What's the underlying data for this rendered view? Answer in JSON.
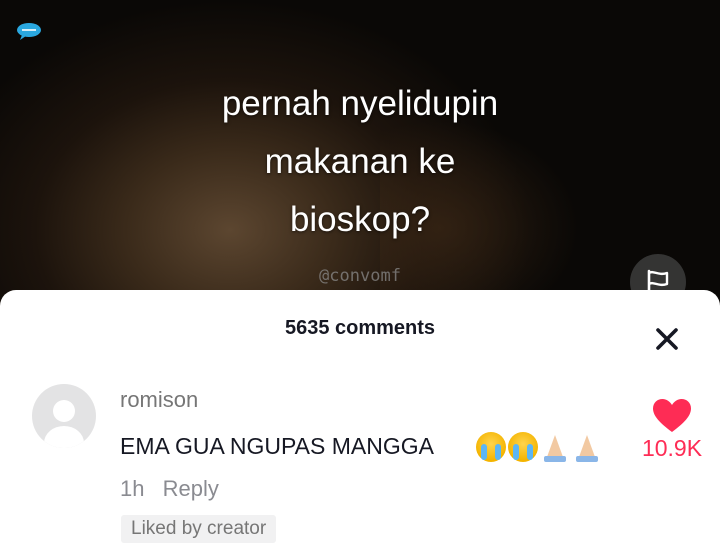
{
  "video": {
    "caption_lines": [
      "pernah nyelidupin",
      "makanan ke",
      "bioskop?"
    ],
    "watermark": "@convomf"
  },
  "comments_panel": {
    "count_label": "5635 comments"
  },
  "comment": {
    "username": "romison",
    "text": "EMA GUA NGUPAS MANGGA",
    "emojis": [
      "loudly-crying-face",
      "loudly-crying-face",
      "folded-hands",
      "folded-hands"
    ],
    "time": "1h",
    "reply_label": "Reply",
    "liked_badge": "Liked by creator",
    "like_count": "10.9K"
  },
  "colors": {
    "like_red": "#fe2c55",
    "text_primary": "#161823",
    "text_secondary": "#767676"
  },
  "icons": [
    "chat-bubble-logo-icon",
    "flag-icon",
    "close-icon",
    "heart-icon"
  ]
}
